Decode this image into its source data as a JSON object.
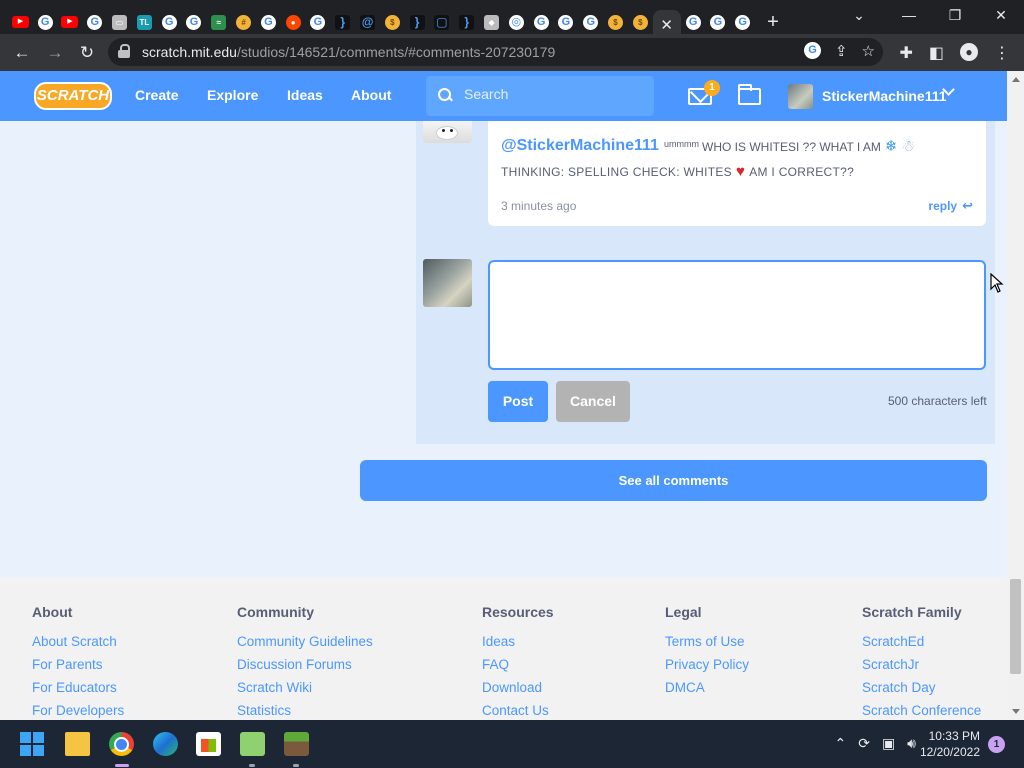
{
  "browser": {
    "url_host": "scratch.mit.edu",
    "url_path": "/studios/146521/comments/#comments-207230179",
    "tab_close_glyph": "✕",
    "new_tab_glyph": "+"
  },
  "nav": {
    "logo_text": "SCRATCH",
    "links": [
      "Create",
      "Explore",
      "Ideas",
      "About"
    ],
    "search_placeholder": "Search",
    "message_count": "1",
    "username": "StickerMachine111"
  },
  "comment": {
    "author": "@StickerMachine111",
    "prefix_small": "ummmm",
    "line1": "WHO IS WHITESI ?? WHAT I AM",
    "line2a": "THINKING: SPELLING CHECK: WHITES",
    "line2b": "AM I CORRECT??",
    "time": "3 minutes ago",
    "reply_label": "reply"
  },
  "composer": {
    "value": "",
    "post_label": "Post",
    "cancel_label": "Cancel",
    "chars_left": "500 characters left"
  },
  "see_all_label": "See all comments",
  "footer": {
    "columns": [
      {
        "heading": "About",
        "links": [
          "About Scratch",
          "For Parents",
          "For Educators",
          "For Developers"
        ]
      },
      {
        "heading": "Community",
        "links": [
          "Community Guidelines",
          "Discussion Forums",
          "Scratch Wiki",
          "Statistics"
        ]
      },
      {
        "heading": "Resources",
        "links": [
          "Ideas",
          "FAQ",
          "Download",
          "Contact Us"
        ]
      },
      {
        "heading": "Legal",
        "links": [
          "Terms of Use",
          "Privacy Policy",
          "DMCA"
        ]
      },
      {
        "heading": "Scratch Family",
        "links": [
          "ScratchEd",
          "ScratchJr",
          "Scratch Day",
          "Scratch Conference"
        ]
      }
    ]
  },
  "taskbar": {
    "time": "10:33 PM",
    "date": "12/20/2022",
    "notifications": "1"
  },
  "colors": {
    "scratch_blue": "#4c97ff",
    "page_bg": "#e9f1fc",
    "footer_bg": "#f2f2f2"
  }
}
